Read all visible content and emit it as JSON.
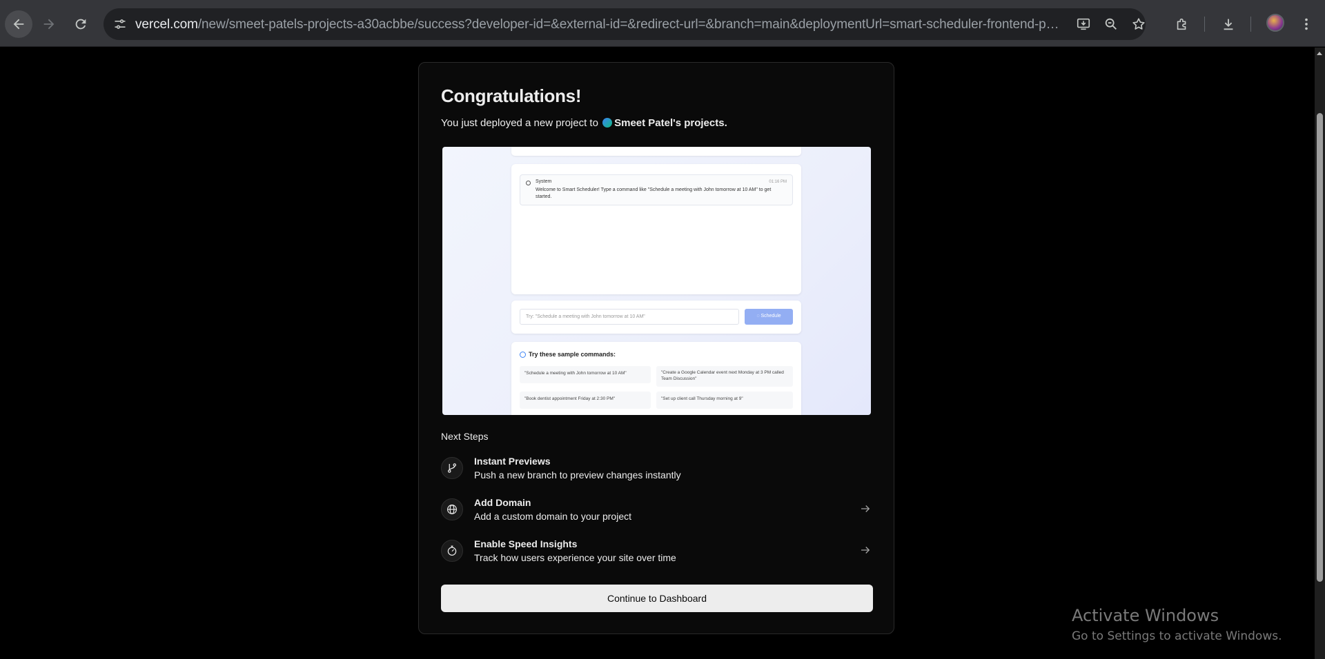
{
  "browser": {
    "url_host": "vercel.com",
    "url_path": "/new/smeet-patels-projects-a30acbbe/success?developer-id=&external-id=&redirect-url=&branch=main&deploymentUrl=smart-scheduler-frontend-p9t5xa0ax..."
  },
  "card": {
    "title": "Congratulations!",
    "subtitle_prefix": "You just deployed a new project to",
    "team_name": "Smeet Patel's projects."
  },
  "preview": {
    "chat_sender": "System",
    "chat_time": "01:16 PM",
    "chat_message": "Welcome to Smart Scheduler! Type a command like \"Schedule a meeting with John tomorrow at 10 AM\" to get started.",
    "input_placeholder": "Try: \"Schedule a meeting with John tomorrow at 10 AM\"",
    "schedule_button": "Schedule",
    "samples_title": "Try these sample commands:",
    "samples": [
      "\"Schedule a meeting with John tomorrow at 10 AM\"",
      "\"Create a Google Calendar event next Monday at 3 PM called Team Discussion\"",
      "\"Book dentist appointment Friday at 2:30 PM\"",
      "\"Set up client call Thursday morning at 9\""
    ]
  },
  "next_steps": {
    "heading": "Next Steps",
    "items": [
      {
        "title": "Instant Previews",
        "description": "Push a new branch to preview changes instantly",
        "icon": "git-branch-icon"
      },
      {
        "title": "Add Domain",
        "description": "Add a custom domain to your project",
        "icon": "globe-icon"
      },
      {
        "title": "Enable Speed Insights",
        "description": "Track how users experience your site over time",
        "icon": "speed-gauge-icon"
      }
    ]
  },
  "cta_label": "Continue to Dashboard",
  "watermark": {
    "title": "Activate Windows",
    "subtitle": "Go to Settings to activate Windows."
  }
}
